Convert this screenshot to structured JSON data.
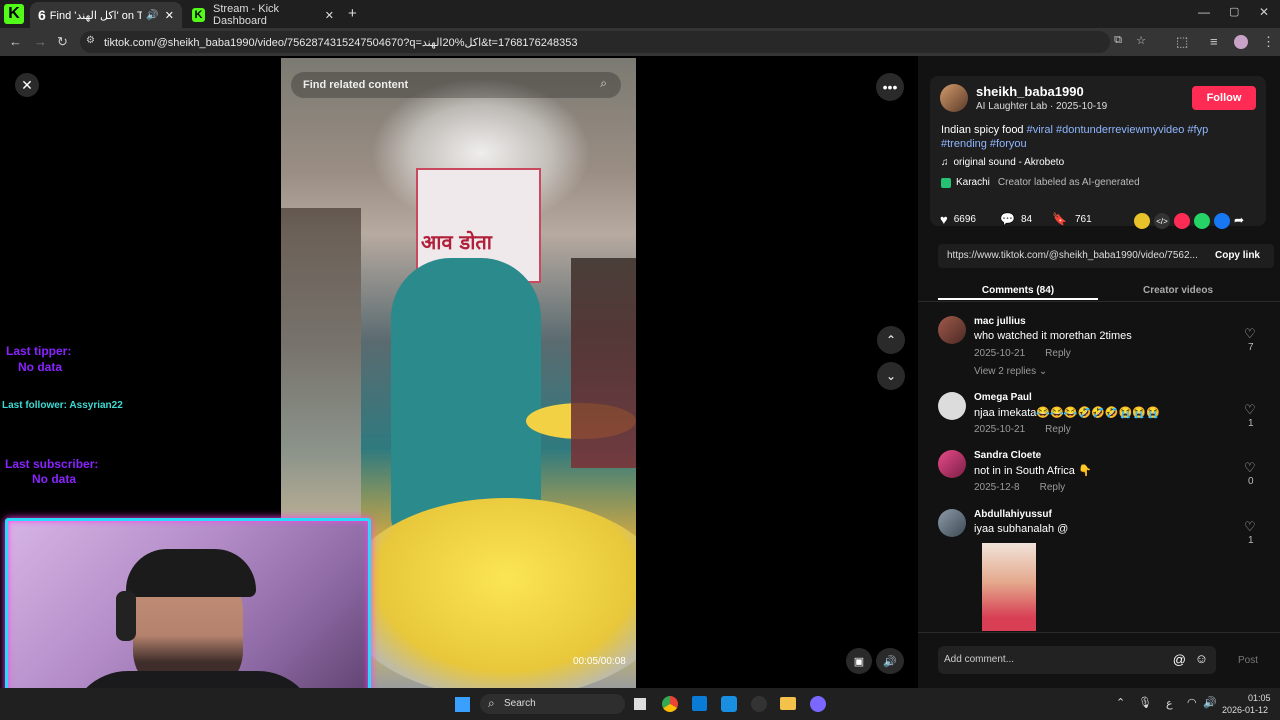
{
  "browser": {
    "tabs": [
      {
        "icon": "kick-icon",
        "title": "Find 'اكل الهند' on TikTok | T",
        "active": true
      },
      {
        "icon": "kick-icon",
        "title": "Stream - Kick Dashboard",
        "active": false
      }
    ],
    "tab_count_badge": "6",
    "new_tab_glyph": "+",
    "url": "tiktok.com/@sheikh_baba1990/video/7562874315247504670?q=اكل%20الهند&t=1768176248353"
  },
  "video": {
    "search_placeholder": "Find related content",
    "sign_text_hindi": "आव डोता",
    "time": "00:05/00:08"
  },
  "post": {
    "username": "sheikh_baba1990",
    "subtitle": "AI Laughter Lab · 2025-10-19",
    "follow_label": "Follow",
    "caption_plain": "Indian spicy food ",
    "hashtags_line1": "#viral #dontunderreviewmyvideo #fyp",
    "hashtags_line2": "#trending #foryou",
    "sound": "original sound - Akrobeto",
    "location": "Karachi",
    "ai_label": "Creator labeled as AI-generated",
    "likes": "6696",
    "comments": "84",
    "saves": "761",
    "link": "https://www.tiktok.com/@sheikh_baba1990/video/7562...",
    "copy_link": "Copy link",
    "tab_comments": "Comments (84)",
    "tab_creator": "Creator videos"
  },
  "comments": [
    {
      "name": "mac jullius",
      "text": "who watched it morethan 2times",
      "date": "2025-10-21",
      "reply": "Reply",
      "likes": "7",
      "view_replies": "View 2 replies"
    },
    {
      "name": "Omega Paul",
      "text": "njaa imekata😂😂😂🤣🤣🤣😭😭😭",
      "date": "2025-10-21",
      "reply": "Reply",
      "likes": "1"
    },
    {
      "name": "Sandra Cloete",
      "text": "not in in South Africa 👇",
      "date": "2025-12-8",
      "reply": "Reply",
      "likes": "0"
    },
    {
      "name": "Abdullahiyussuf",
      "text": "iyaa subhanalah @",
      "likes": "1"
    }
  ],
  "add_comment": {
    "placeholder": "Add comment...",
    "post": "Post"
  },
  "overlay": {
    "last_tipper_label": "Last tipper:",
    "last_tipper_value": "No data",
    "last_follower": "Last follower: Assyrian22",
    "last_subscriber_label": "Last subscriber:",
    "last_subscriber_value": "No data"
  },
  "taskbar": {
    "search": "Search",
    "lang": "ع",
    "time": "01:05",
    "date": "2026-01-12"
  }
}
